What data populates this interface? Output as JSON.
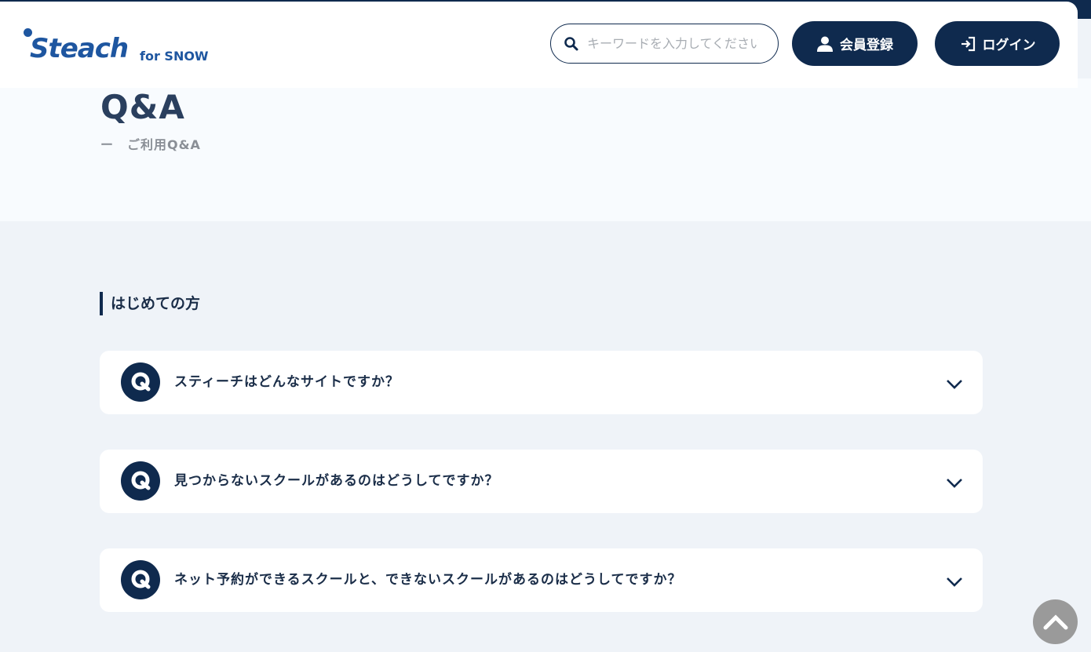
{
  "header": {
    "logo_text": "Steach",
    "logo_subtext": "for SNOW",
    "search": {
      "placeholder": "キーワードを入力してください"
    },
    "register_label": "会員登録",
    "login_label": "ログイン"
  },
  "hero": {
    "title": "Q&A",
    "subtitle": "ー　ご利用Q&A"
  },
  "section": {
    "heading": "はじめての方",
    "faqs": [
      {
        "question": "スティーチはどんなサイトですか？"
      },
      {
        "question": "見つからないスクールがあるのはどうしてですか？"
      },
      {
        "question": "ネット予約ができるスクールと、できないスクールがあるのはどうしてですか？"
      }
    ]
  },
  "colors": {
    "navy": "#0f2a4e",
    "brand_blue": "#1e56a0",
    "page_bg": "#eff3f8",
    "hero_bg": "#f8fbfe"
  },
  "icons": {
    "search": "search-icon",
    "user": "user-icon",
    "login": "login-icon",
    "q_badge": "q-badge-icon",
    "chevron": "chevron-down-icon",
    "back_to_top": "chevron-up-icon"
  }
}
